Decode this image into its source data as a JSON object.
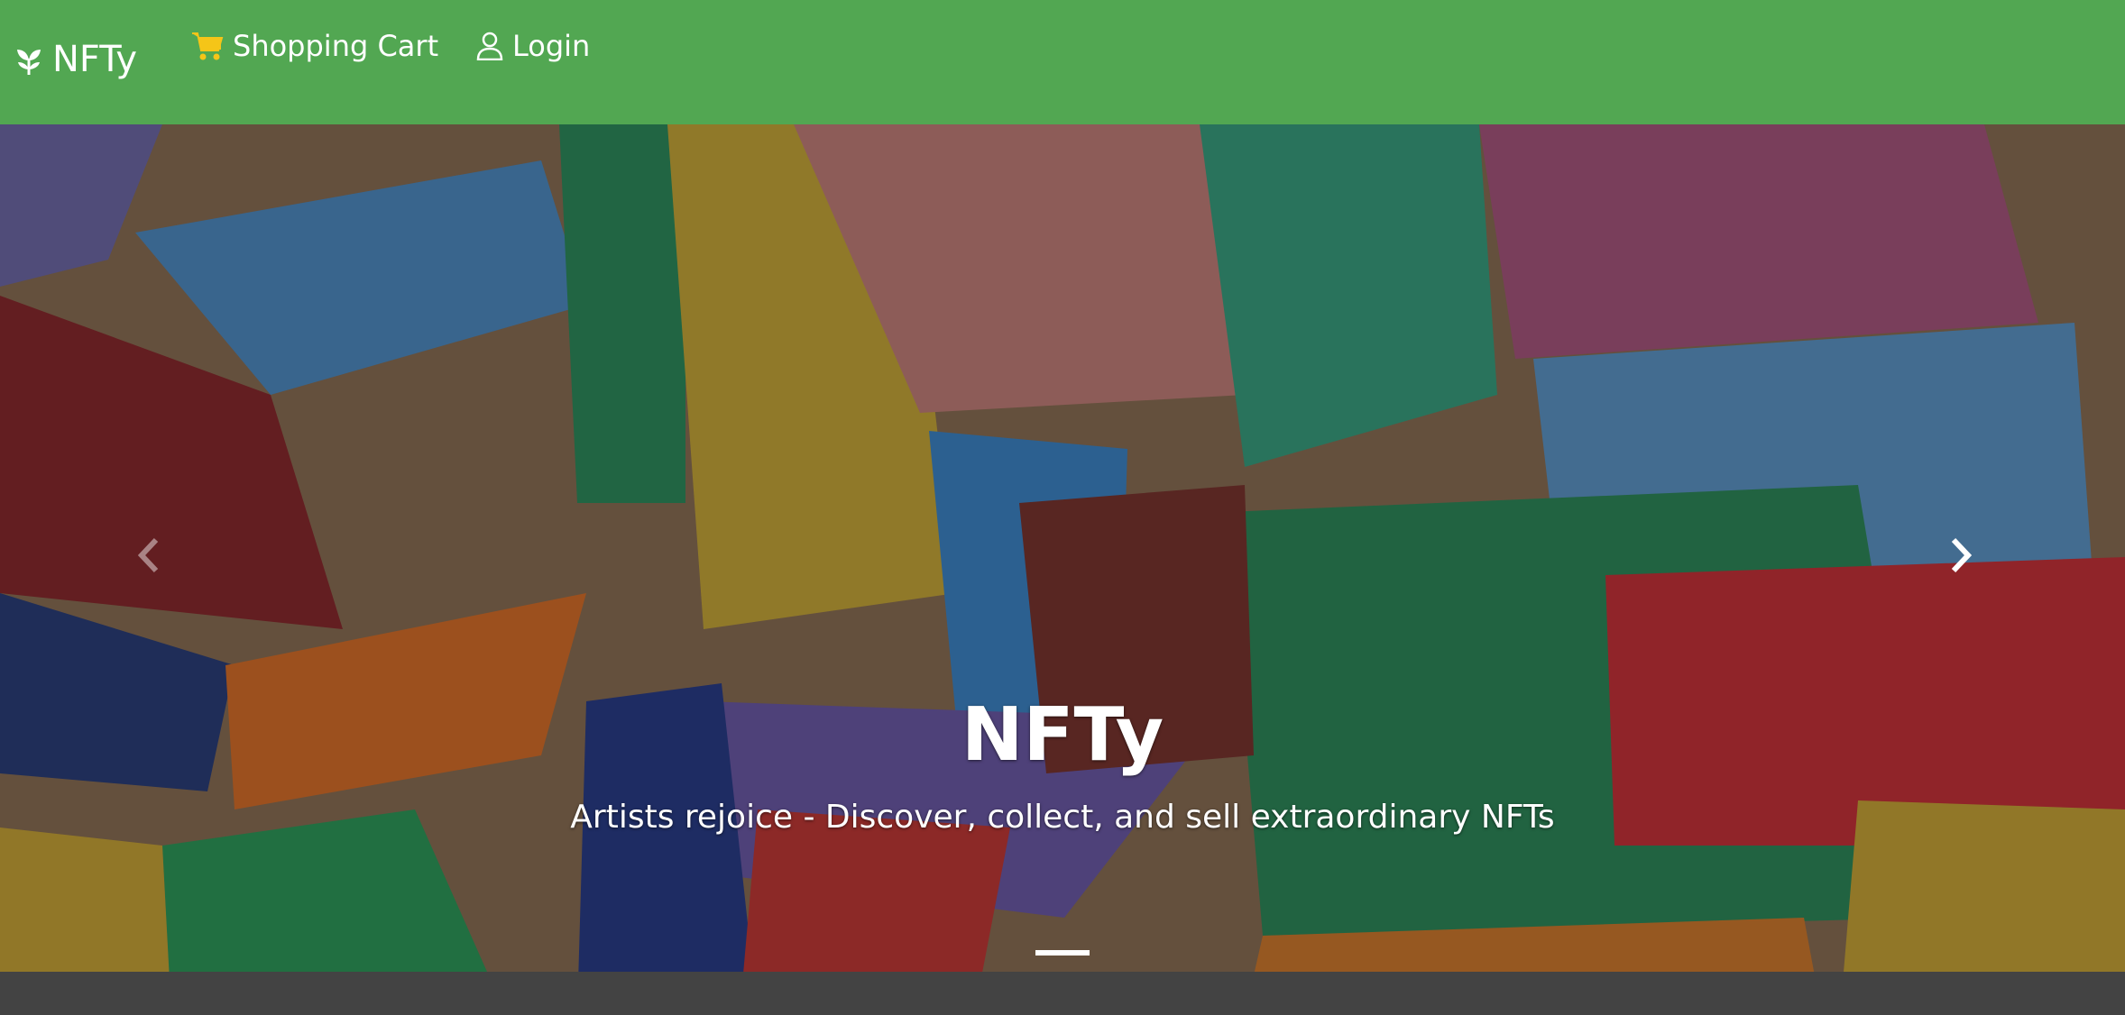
{
  "navbar": {
    "brand": "NFTy",
    "brand_icon": "sprout-icon",
    "links": [
      {
        "label": "Shopping Cart",
        "icon": "cart-icon",
        "icon_color": "#f5c518"
      },
      {
        "label": "Login",
        "icon": "user-icon"
      }
    ],
    "background": "#52a752"
  },
  "hero": {
    "title": "NFTy",
    "subtitle": "Artists rejoice - Discover, collect, and sell extraordinary NFTs",
    "slides_count": 1,
    "active_slide": 1,
    "image_description_icon": "mural-image",
    "prev_icon": "chevron-left-icon",
    "next_icon": "chevron-right-icon"
  }
}
